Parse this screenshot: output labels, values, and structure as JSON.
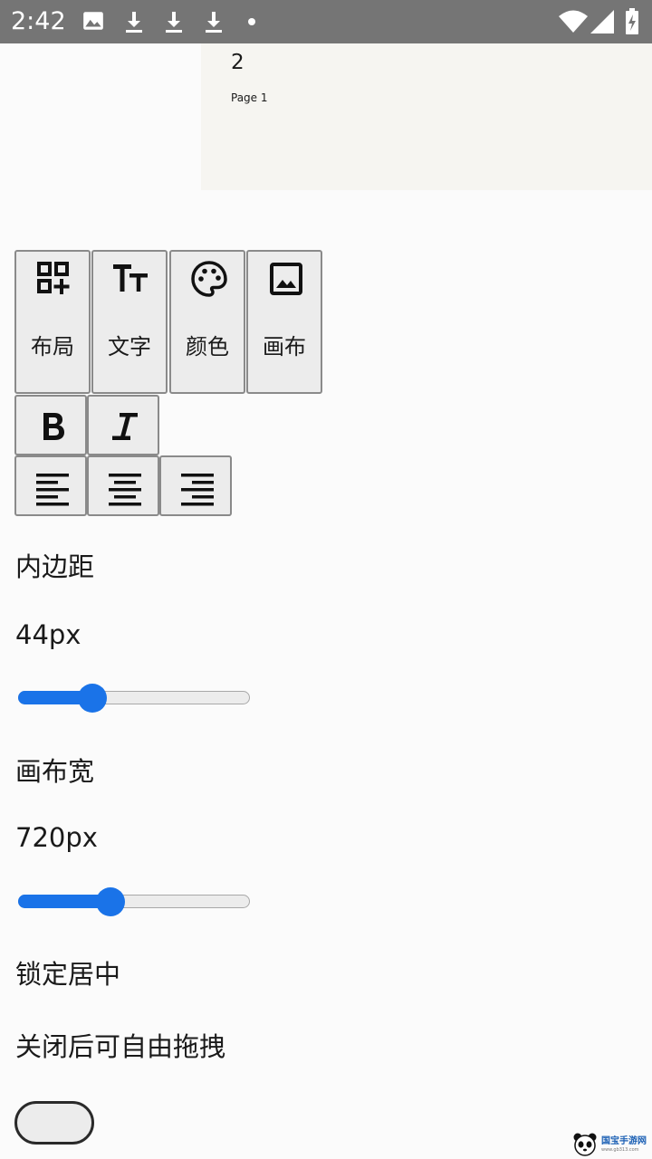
{
  "status_bar": {
    "time": "2:42",
    "left_icons": [
      "image-icon",
      "download-icon",
      "download-icon",
      "download-icon",
      "dot-icon"
    ],
    "right_icons": [
      "wifi-icon",
      "cell-signal-icon",
      "battery-charging-icon"
    ]
  },
  "preview": {
    "number": "2",
    "page_label": "Page 1"
  },
  "toolbar": {
    "tabs": [
      {
        "label": "布局",
        "icon": "layout-add-icon"
      },
      {
        "label": "文字",
        "icon": "text-size-icon"
      },
      {
        "label": "颜色",
        "icon": "palette-icon"
      },
      {
        "label": "画布",
        "icon": "image-icon"
      }
    ]
  },
  "format": {
    "style_buttons": [
      "bold-icon",
      "italic-icon"
    ],
    "align_buttons": [
      "align-left-icon",
      "align-center-icon",
      "align-right-icon"
    ]
  },
  "controls": {
    "padding": {
      "label": "内边距",
      "value_text": "44px",
      "slider_fraction": 0.32
    },
    "canvas_width": {
      "label": "画布宽",
      "value_text": "720px",
      "slider_fraction": 0.4
    },
    "lock_center": {
      "label": "锁定居中",
      "description": "关闭后可自由拖拽",
      "enabled": false
    }
  },
  "watermark": {
    "text": "国宝手游网",
    "sub": "www.gb313.com"
  },
  "colors": {
    "accent": "#1a73e8",
    "status_bar": "#757575",
    "button_bg": "#ececec",
    "button_border": "#8a8a8a"
  }
}
